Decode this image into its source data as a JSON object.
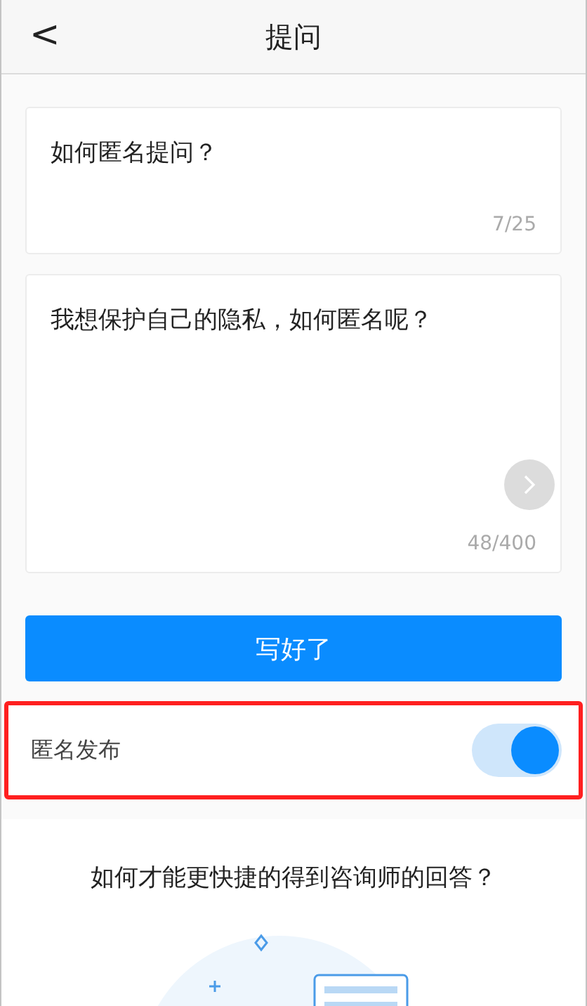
{
  "header": {
    "back": "<",
    "title": "提问"
  },
  "question": {
    "value": "如何匿名提问？",
    "count": "7/25"
  },
  "description": {
    "value": "我想保护自己的隐私，如何匿名呢？",
    "count": "48/400"
  },
  "submit": "写好了",
  "anonymous": {
    "label": "匿名发布",
    "on": true,
    "highlighted": true
  },
  "tips": {
    "title": "如何才能更快捷的得到咨询师的回答？"
  }
}
